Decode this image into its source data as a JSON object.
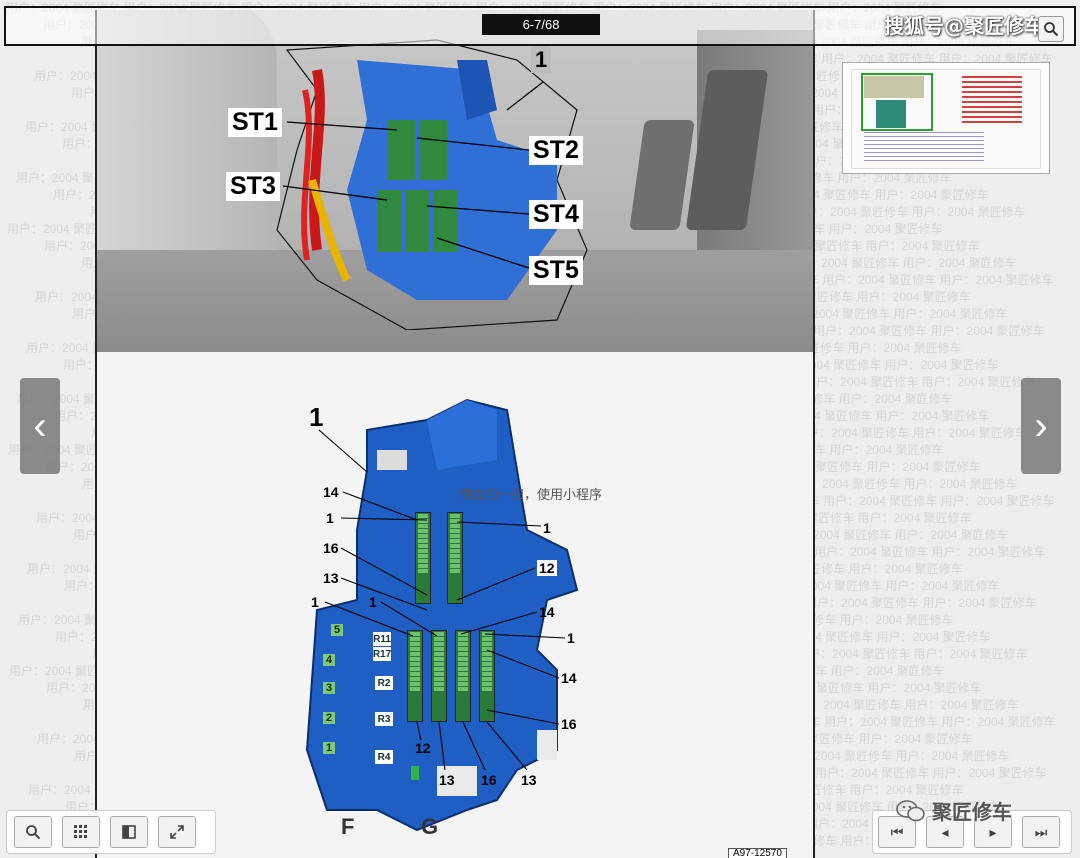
{
  "viewer": {
    "page_indicator": "6-7/68",
    "brand_top": "搜狐号@聚匠修车",
    "brand_bottom": "聚匠修车",
    "qr_hint": "微信扫一扫，使用小程序",
    "figure_code": "A97-12570",
    "nav_prev_glyph": "‹",
    "nav_next_glyph": "›",
    "toolbar": {
      "zoom_icon": "magnifier-icon",
      "grid_icon": "grid-icon",
      "book_icon": "book-icon",
      "fullscreen_icon": "expand-icon"
    },
    "pager_buttons": [
      "⏮",
      "◂",
      "▸",
      "⏭"
    ]
  },
  "photo_callouts": {
    "st1": "ST1",
    "st2": "ST2",
    "st3": "ST3",
    "st4": "ST4",
    "st5": "ST5",
    "part1": "1"
  },
  "diagram": {
    "part_label": "1",
    "pin_labels": {
      "a14": "14",
      "a1_left": "1",
      "a1_right": "1",
      "a16": "16",
      "a12_top": "12",
      "a13_left": "13",
      "a1_l2": "1",
      "a1_l3": "1",
      "a14_mid": "14",
      "a1_mid": "1",
      "a14_right": "14",
      "a16_right": "16",
      "b12": "12",
      "b13": "13",
      "b16": "16",
      "b13_right": "13"
    },
    "slots": [
      "5",
      "4",
      "3",
      "2",
      "1"
    ],
    "relays": [
      "R11",
      "R17",
      "R2",
      "R3",
      "R4"
    ],
    "connectors": [
      "F",
      "G"
    ]
  },
  "watermark_line": "用户：2004 聚匠修车  用户：2004 聚匠修车  用户：2004 聚匠修车  用户：2004 聚匠修车  用户：2004 聚匠修车  用户：2004 聚匠修车  用户：2004 聚匠修车  用户：2004 聚匠修车"
}
